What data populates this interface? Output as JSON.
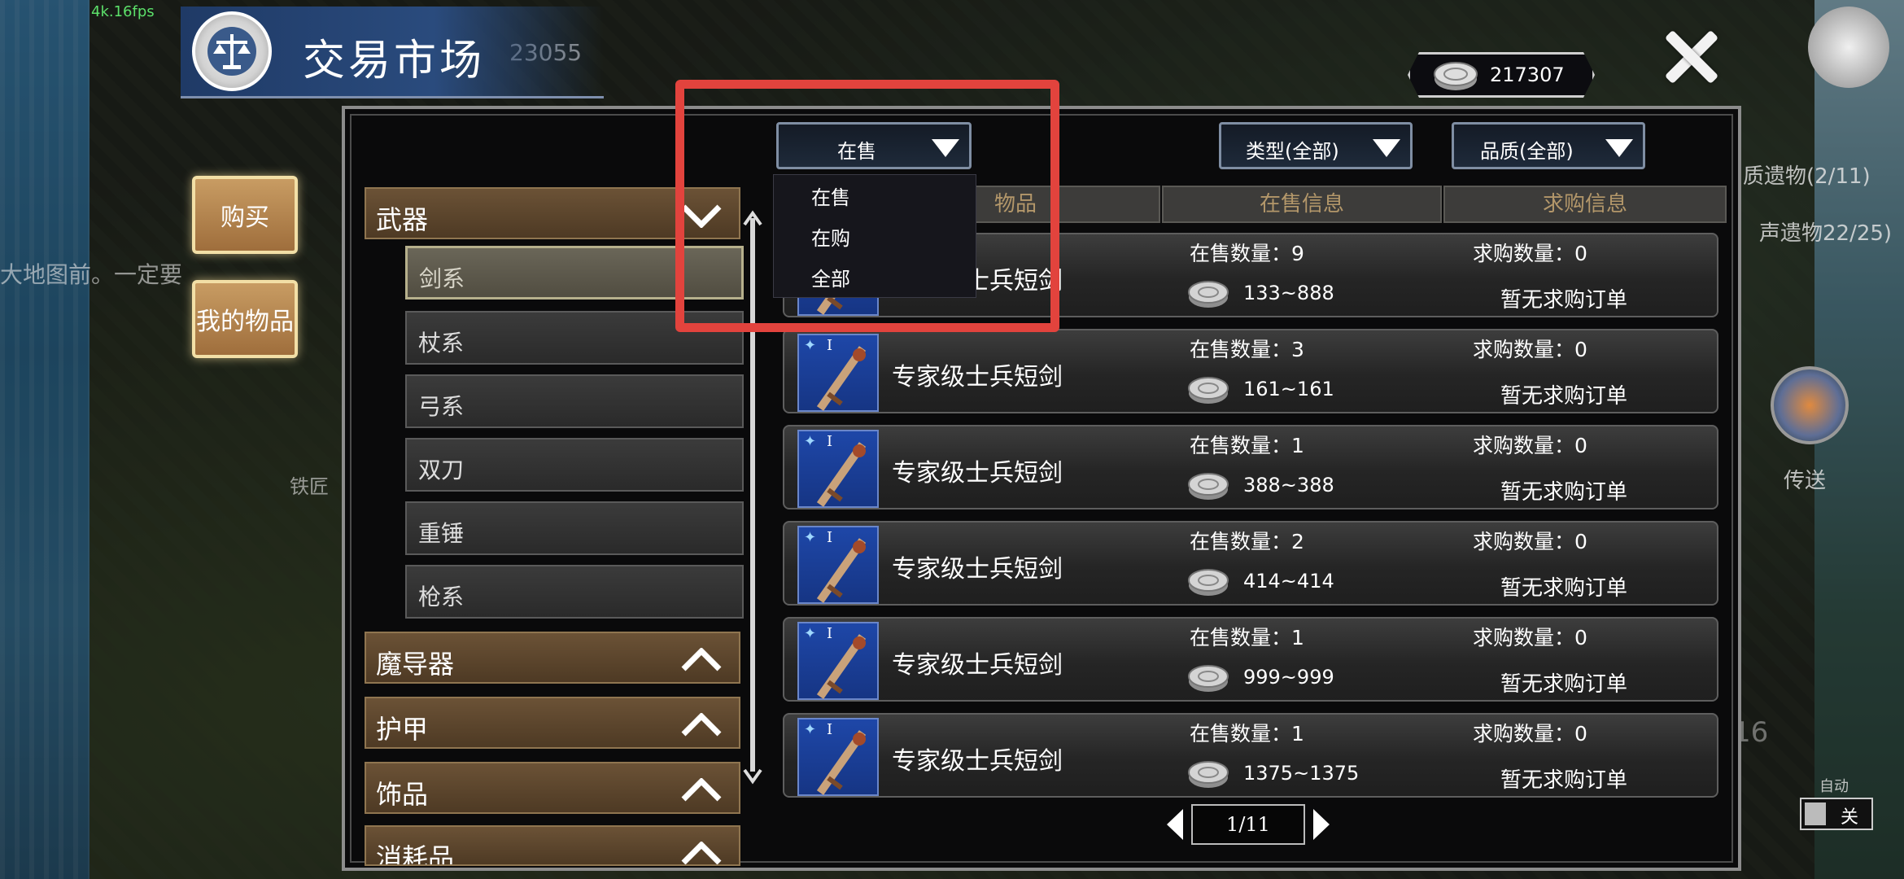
{
  "hud": {
    "fps": "4k.16fps",
    "bg_number": "23055",
    "bg_text_left": "大地图前。一定要",
    "bg_npc": "铁匠",
    "right_quest_1": "质遗物(2/11)",
    "right_quest_2": "声遗物22/25)",
    "right_portal_label": "传送",
    "right_timer": "16",
    "auto_label": "自动",
    "auto_toggle": "关"
  },
  "header": {
    "title": "交易市场",
    "currency_amount": "217307"
  },
  "left_buttons": {
    "buy": "购买",
    "my_items": "我的物品"
  },
  "categories": [
    {
      "label": "武器",
      "expanded": true
    },
    {
      "label": "魔导器",
      "expanded": false
    },
    {
      "label": "护甲",
      "expanded": false
    },
    {
      "label": "饰品",
      "expanded": false
    },
    {
      "label": "消耗品",
      "expanded": false
    }
  ],
  "subcategories": [
    "剑系",
    "杖系",
    "弓系",
    "双刀",
    "重锤",
    "枪系"
  ],
  "selected_subcategory": "剑系",
  "filters": {
    "status": "在售",
    "type": "类型(全部)",
    "quality": "品质(全部)"
  },
  "status_menu": [
    "在售",
    "在购",
    "全部"
  ],
  "columns": [
    "物品",
    "在售信息",
    "求购信息"
  ],
  "rows": [
    {
      "name": "专家级士兵短剑",
      "tier": "I",
      "sale_qty": "在售数量：9",
      "price": "133~888",
      "buy_qty": "求购数量：0",
      "buy_status": "暂无求购订单"
    },
    {
      "name": "专家级士兵短剑",
      "tier": "I",
      "sale_qty": "在售数量：3",
      "price": "161~161",
      "buy_qty": "求购数量：0",
      "buy_status": "暂无求购订单"
    },
    {
      "name": "专家级士兵短剑",
      "tier": "I",
      "sale_qty": "在售数量：1",
      "price": "388~388",
      "buy_qty": "求购数量：0",
      "buy_status": "暂无求购订单"
    },
    {
      "name": "专家级士兵短剑",
      "tier": "I",
      "sale_qty": "在售数量：2",
      "price": "414~414",
      "buy_qty": "求购数量：0",
      "buy_status": "暂无求购订单"
    },
    {
      "name": "专家级士兵短剑",
      "tier": "I",
      "sale_qty": "在售数量：1",
      "price": "999~999",
      "buy_qty": "求购数量：0",
      "buy_status": "暂无求购订单"
    },
    {
      "name": "专家级士兵短剑",
      "tier": "I",
      "sale_qty": "在售数量：1",
      "price": "1375~1375",
      "buy_qty": "求购数量：0",
      "buy_status": "暂无求购订单"
    }
  ],
  "pagination": {
    "page": "1/11"
  },
  "colors": {
    "highlight": "#e2433d",
    "accent_gold": "#b3976a",
    "panel": "#0a0a0b"
  }
}
